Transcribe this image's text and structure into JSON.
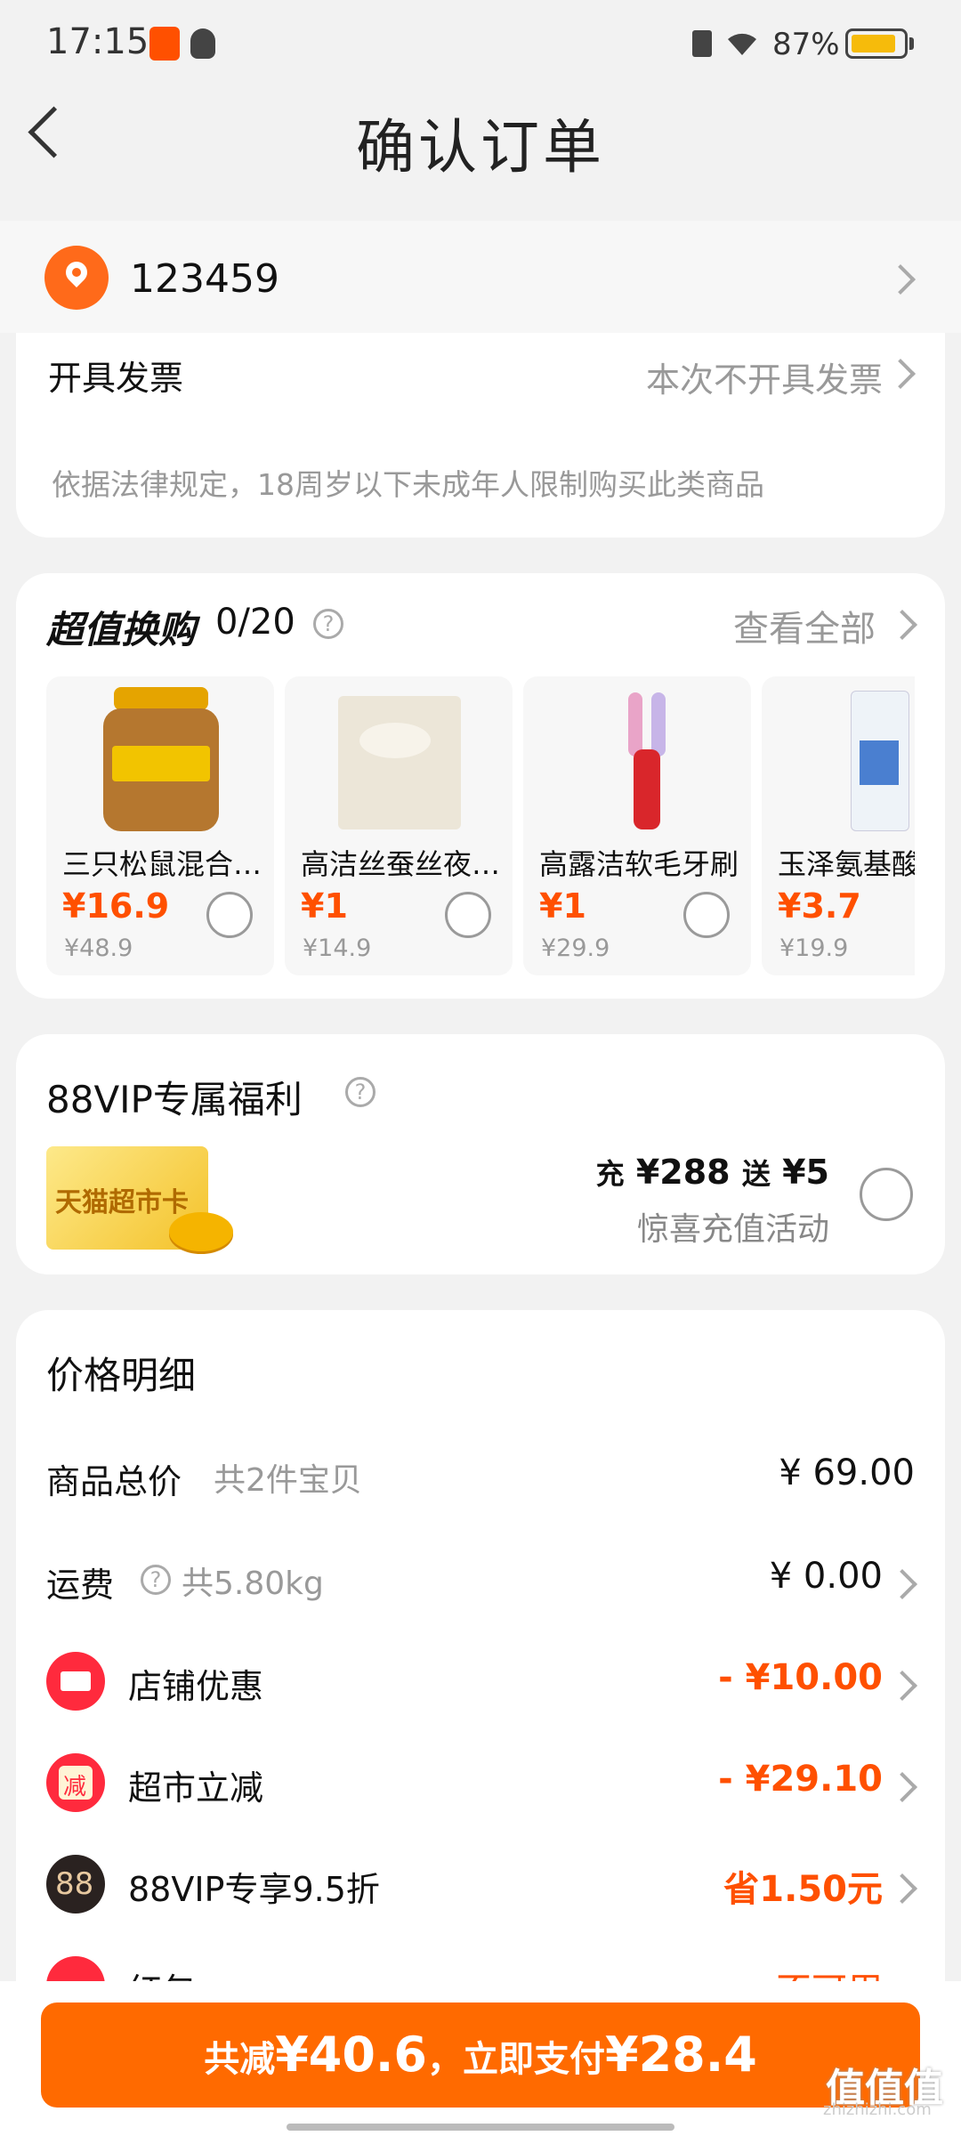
{
  "status_bar": {
    "time": "17:15",
    "battery_text": "87%",
    "battery_level": 0.87
  },
  "nav": {
    "title": "确认订单"
  },
  "address": {
    "text": "123459"
  },
  "invoice": {
    "label": "开具发票",
    "value": "本次不开具发票",
    "notice": "依据法律规定，18周岁以下未成年人限制购买此类商品"
  },
  "exchange": {
    "title": "超值换购",
    "count": "0/20",
    "view_all": "查看全部",
    "products": [
      {
        "name": "三只松鼠混合坚果",
        "price": "¥16.9",
        "orig": "¥48.9"
      },
      {
        "name": "高洁丝蚕丝夜安裤",
        "price": "¥1",
        "orig": "¥14.9"
      },
      {
        "name": "高露洁软毛牙刷",
        "price": "¥1",
        "orig": "¥29.9"
      },
      {
        "name": "玉泽氨基酸",
        "price": "¥3.7",
        "orig": "¥19.9"
      }
    ]
  },
  "vip": {
    "title": "88VIP专属福利",
    "card_label": "天猫超市卡",
    "offer_pre": "充",
    "offer_amount": "¥288",
    "offer_mid": "送",
    "offer_bonus": "¥5",
    "offer_desc": "惊喜充值活动"
  },
  "price_detail": {
    "title": "价格明细",
    "rows": [
      {
        "label": "商品总价",
        "sub": "共2件宝贝",
        "value": "¥ 69.00"
      },
      {
        "label": "运费",
        "sub": "共5.80kg",
        "value": "¥ 0.00"
      },
      {
        "label": "店铺优惠",
        "value": "- ¥10.00"
      },
      {
        "label": "超市立减",
        "value": "- ¥29.10",
        "icon_text": "减"
      },
      {
        "label": "88VIP专享9.5折",
        "value": "省1.50元",
        "icon_text": "88"
      },
      {
        "label": "红包",
        "value": "不可用"
      }
    ]
  },
  "pay": {
    "pre": "共减",
    "reduce": "¥40.6",
    "mid": "，立即支付",
    "total": "¥28.4"
  },
  "watermark": {
    "text": "值值值",
    "url": "zhizhizhi.com"
  },
  "colors": {
    "accent": "#ff5000",
    "button": "#ff6a00",
    "battery": "#f6bb0b"
  }
}
